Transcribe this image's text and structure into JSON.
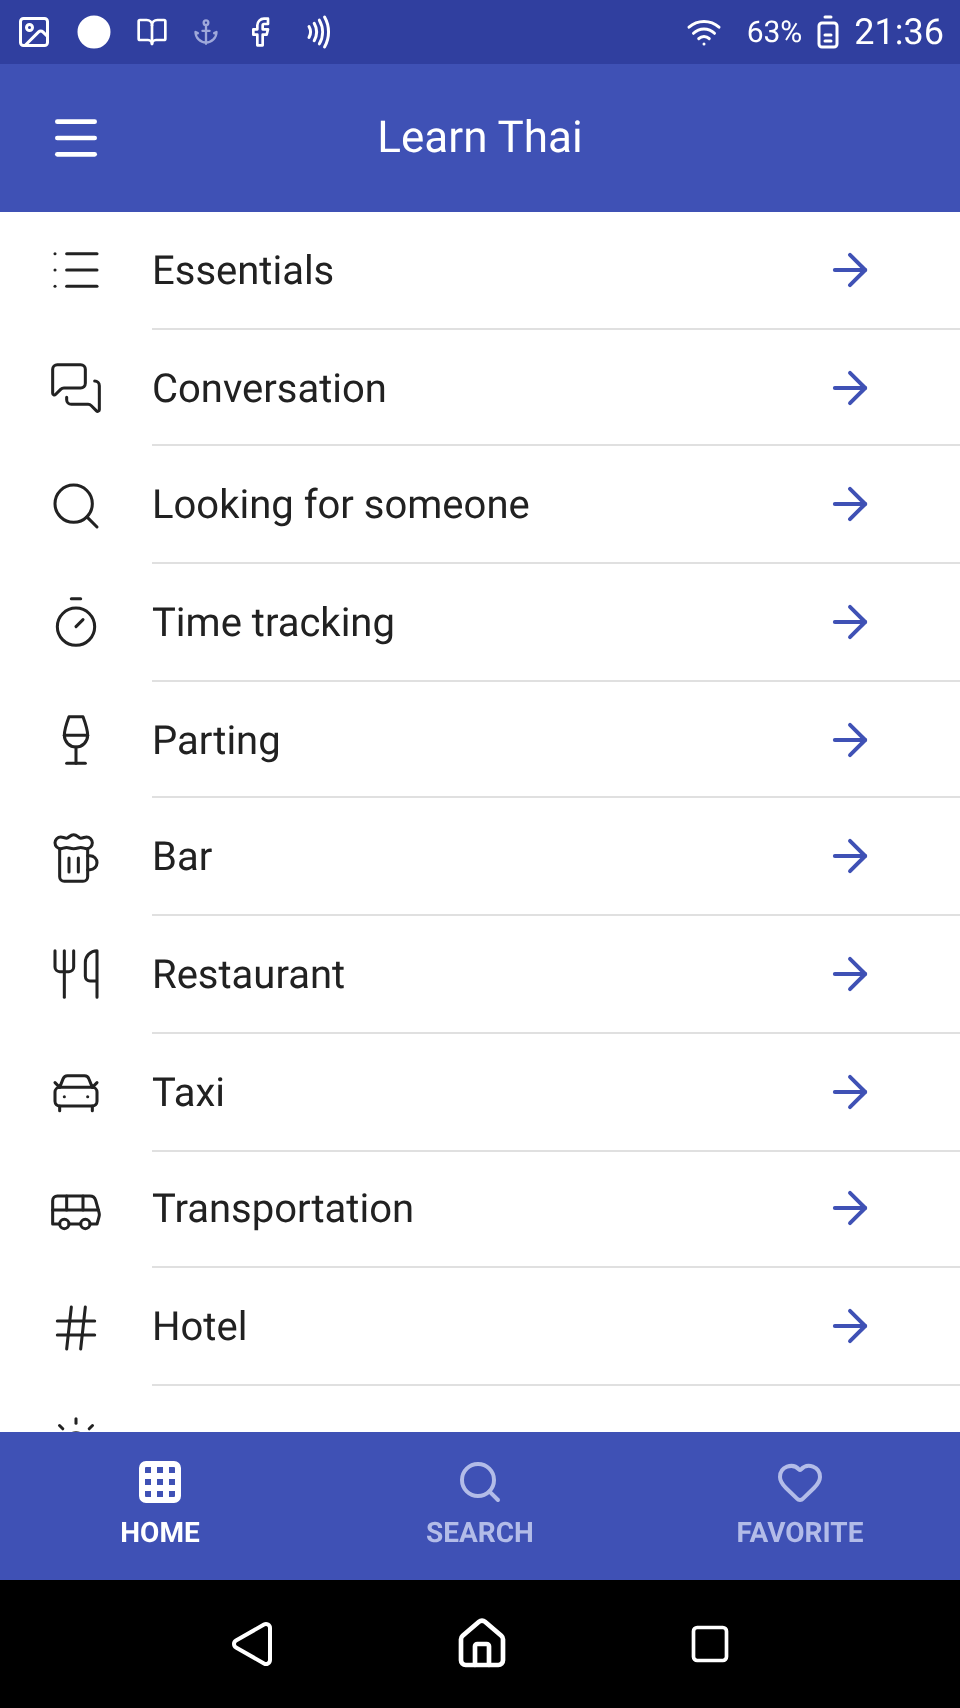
{
  "status_bar": {
    "battery": "63%",
    "time": "21:36"
  },
  "app_bar": {
    "title": "Learn Thai"
  },
  "list": [
    {
      "label": "Essentials"
    },
    {
      "label": "Conversation"
    },
    {
      "label": "Looking for someone"
    },
    {
      "label": "Time tracking"
    },
    {
      "label": "Parting"
    },
    {
      "label": "Bar"
    },
    {
      "label": "Restaurant"
    },
    {
      "label": "Taxi"
    },
    {
      "label": "Transportation"
    },
    {
      "label": "Hotel"
    }
  ],
  "bottom_nav": [
    {
      "label": "HOME",
      "selected": true
    },
    {
      "label": "SEARCH",
      "selected": false
    },
    {
      "label": "FAVORITE",
      "selected": false
    }
  ]
}
